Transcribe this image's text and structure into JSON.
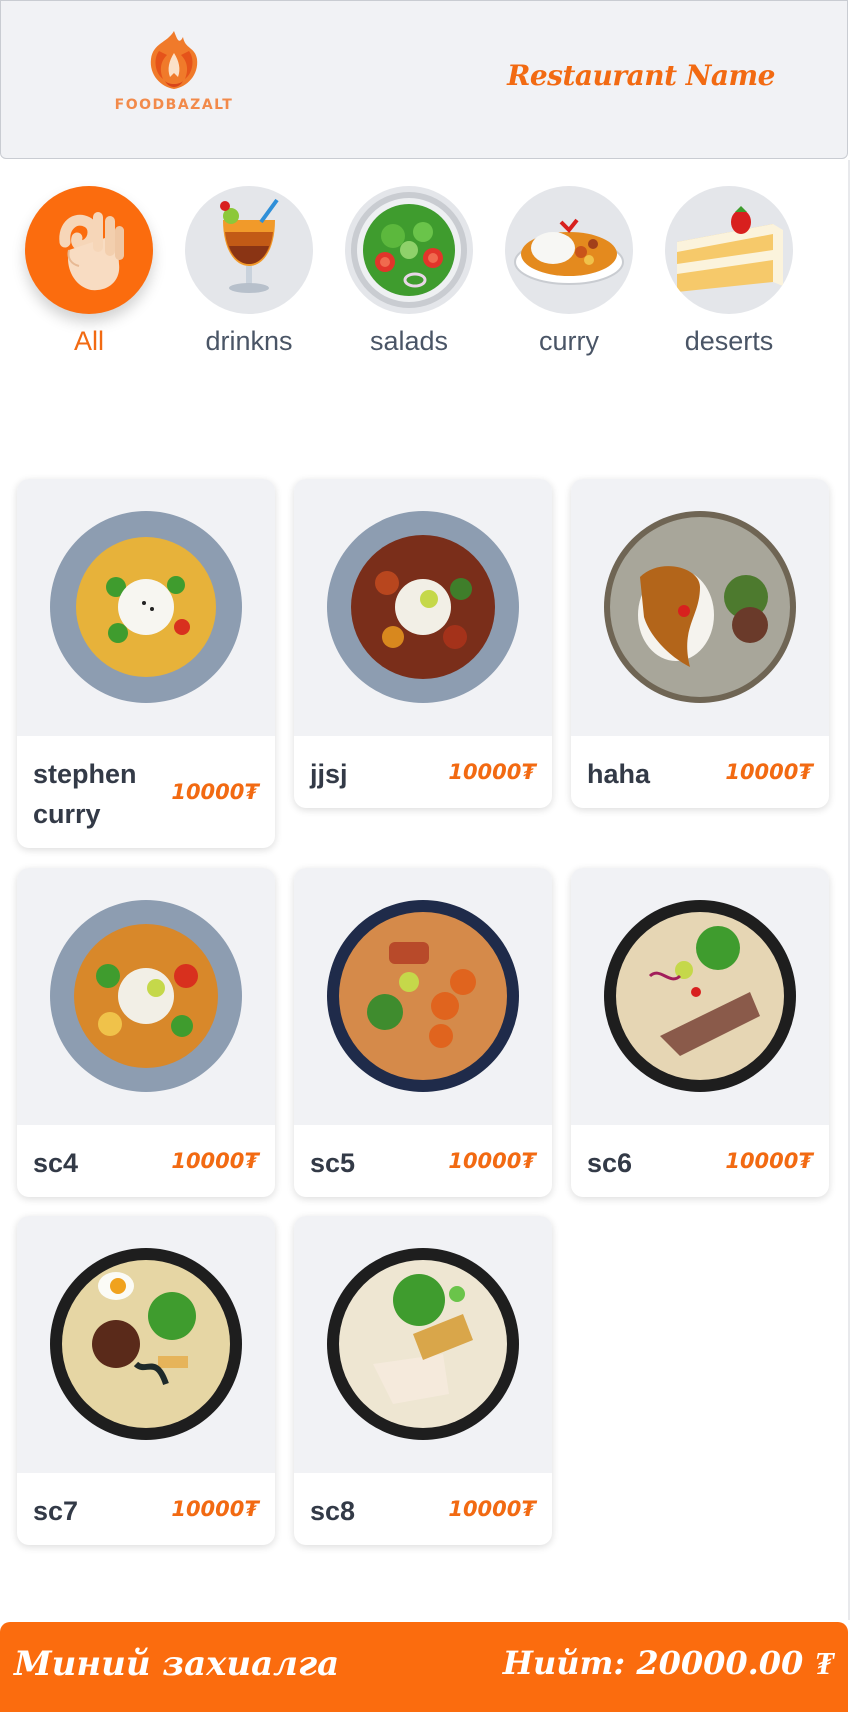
{
  "header": {
    "logo_text": "FOODBAZALT",
    "restaurant_name": "Restaurant Name"
  },
  "categories": [
    {
      "label": "All",
      "icon": "ok-hand-icon",
      "active": true
    },
    {
      "label": "drinkns",
      "icon": "tropical-drink-icon",
      "active": false
    },
    {
      "label": "salads",
      "icon": "salad-bowl-icon",
      "active": false
    },
    {
      "label": "curry",
      "icon": "curry-rice-icon",
      "active": false
    },
    {
      "label": "deserts",
      "icon": "cake-slice-icon",
      "active": false
    }
  ],
  "menu": [
    {
      "name": "stephen curry",
      "price": "10000₮",
      "image": "yellow-curry-bowl"
    },
    {
      "name": "jjsj",
      "price": "10000₮",
      "image": "stir-fry-rice-bowl"
    },
    {
      "name": "haha",
      "price": "10000₮",
      "image": "katsu-curry-plate"
    },
    {
      "name": "sc4",
      "price": "10000₮",
      "image": "tofu-stir-fry-bowl"
    },
    {
      "name": "sc5",
      "price": "10000₮",
      "image": "shrimp-ramen-bowl"
    },
    {
      "name": "sc6",
      "price": "10000₮",
      "image": "beef-noodle-bowl"
    },
    {
      "name": "sc7",
      "price": "10000₮",
      "image": "egg-ramen-bowl"
    },
    {
      "name": "sc8",
      "price": "10000₮",
      "image": "chicken-noodle-bowl"
    }
  ],
  "order_bar": {
    "label": "Миний захиалга",
    "total": "Нийт: 20000.00 ₮"
  },
  "colors": {
    "accent": "#fb6c0e",
    "header_bg": "#f1f2f5",
    "card_image_bg": "#f1f2f5",
    "category_bg": "#e4e6ea",
    "text_dark": "#333a47",
    "text_muted": "#4a5566"
  }
}
